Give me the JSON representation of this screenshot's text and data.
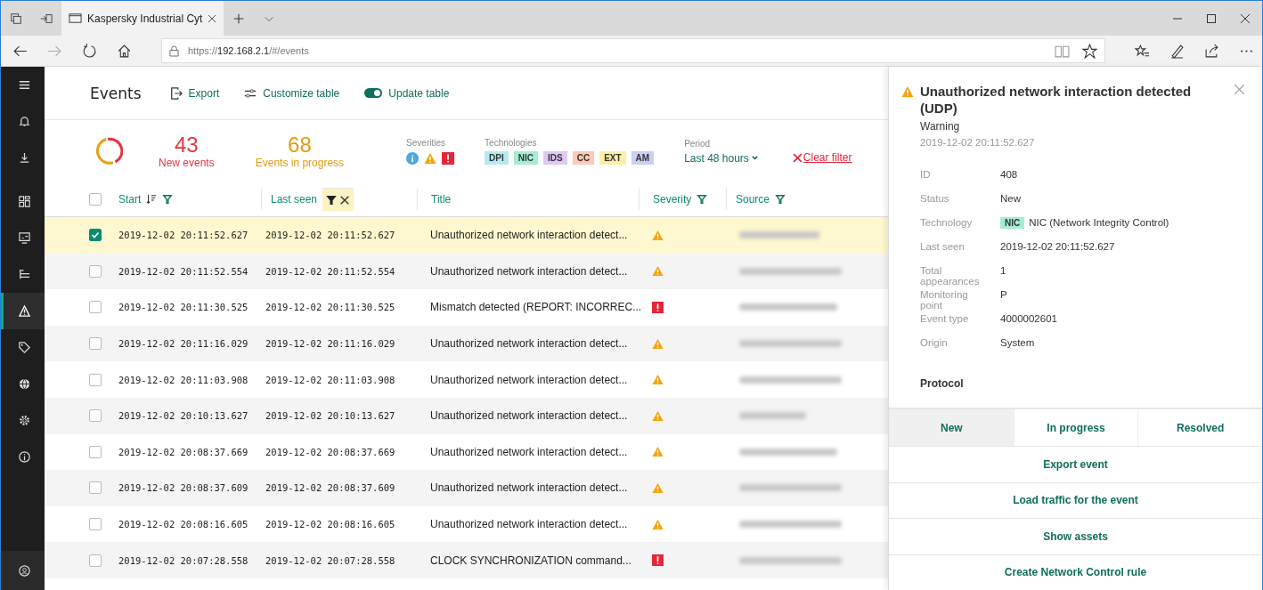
{
  "browser": {
    "tab_title": "Kaspersky Industrial Cyt",
    "url": {
      "scheme": "https://",
      "host": "192.168.2.1",
      "path": "/#/events"
    }
  },
  "sidebar": {
    "items": [
      {
        "selected": false
      },
      {
        "selected": false
      },
      {
        "selected": false
      },
      {
        "selected": false
      },
      {
        "selected": false
      },
      {
        "selected": false
      },
      {
        "selected": true
      },
      {
        "selected": false
      },
      {
        "selected": false
      },
      {
        "selected": false
      },
      {
        "selected": false
      }
    ]
  },
  "toolbar": {
    "title": "Events",
    "export": "Export",
    "customize": "Customize table",
    "update": {
      "label": "Update table",
      "on": true
    }
  },
  "stats": {
    "new_count": "43",
    "new_label": "New events",
    "progress_count": "68",
    "progress_label": "Events in progress"
  },
  "filters": {
    "severities_label": "Severities",
    "severities": [
      {
        "kind": "info"
      },
      {
        "kind": "warning"
      },
      {
        "kind": "error"
      }
    ],
    "technologies_label": "Technologies",
    "technologies": [
      {
        "label": "DPI",
        "color": "#b3ecf0"
      },
      {
        "label": "NIC",
        "color": "#a6ecd0"
      },
      {
        "label": "IDS",
        "color": "#dfc9f5"
      },
      {
        "label": "CC",
        "color": "#fcc9b8"
      },
      {
        "label": "EXT",
        "color": "#fcefa6"
      },
      {
        "label": "AM",
        "color": "#c9cff5"
      }
    ],
    "period_label": "Period",
    "period": "Last 48 hours",
    "clear": "Clear filter"
  },
  "table": {
    "select_all_checked": false,
    "columns": [
      {
        "label": "Start",
        "sorted": true,
        "filter": true,
        "filter_active": false
      },
      {
        "label": "Last seen",
        "sorted": false,
        "filter": true,
        "filter_active": true
      },
      {
        "label": "Title",
        "sorted": false,
        "filter": false,
        "filter_active": false
      },
      {
        "label": "Severity",
        "sorted": false,
        "filter": true,
        "filter_active": false
      },
      {
        "label": "Source",
        "sorted": false,
        "filter": true,
        "filter_active": false
      }
    ],
    "rows": [
      {
        "checked": true,
        "selected": true,
        "start": "2019-12-02 20:11:52.627",
        "last_seen": "2019-12-02 20:11:52.627",
        "title": "Unauthorized network interaction detect...",
        "kind": "warning"
      },
      {
        "checked": false,
        "selected": false,
        "start": "2019-12-02 20:11:52.554",
        "last_seen": "2019-12-02 20:11:52.554",
        "title": "Unauthorized network interaction detect...",
        "kind": "warning"
      },
      {
        "checked": false,
        "selected": false,
        "start": "2019-12-02 20:11:30.525",
        "last_seen": "2019-12-02 20:11:30.525",
        "title": "Mismatch detected (REPORT: INCORREC...",
        "kind": "error"
      },
      {
        "checked": false,
        "selected": false,
        "start": "2019-12-02 20:11:16.029",
        "last_seen": "2019-12-02 20:11:16.029",
        "title": "Unauthorized network interaction detect...",
        "kind": "warning"
      },
      {
        "checked": false,
        "selected": false,
        "start": "2019-12-02 20:11:03.908",
        "last_seen": "2019-12-02 20:11:03.908",
        "title": "Unauthorized network interaction detect...",
        "kind": "warning"
      },
      {
        "checked": false,
        "selected": false,
        "start": "2019-12-02 20:10:13.627",
        "last_seen": "2019-12-02 20:10:13.627",
        "title": "Unauthorized network interaction detect...",
        "kind": "warning"
      },
      {
        "checked": false,
        "selected": false,
        "start": "2019-12-02 20:08:37.669",
        "last_seen": "2019-12-02 20:08:37.669",
        "title": "Unauthorized network interaction detect...",
        "kind": "warning"
      },
      {
        "checked": false,
        "selected": false,
        "start": "2019-12-02 20:08:37.609",
        "last_seen": "2019-12-02 20:08:37.609",
        "title": "Unauthorized network interaction detect...",
        "kind": "warning"
      },
      {
        "checked": false,
        "selected": false,
        "start": "2019-12-02 20:08:16.605",
        "last_seen": "2019-12-02 20:08:16.605",
        "title": "Unauthorized network interaction detect...",
        "kind": "warning"
      },
      {
        "checked": false,
        "selected": false,
        "start": "2019-12-02 20:07:28.558",
        "last_seen": "2019-12-02 20:07:28.558",
        "title": "CLOCK SYNCHRONIZATION command...",
        "kind": "error"
      }
    ]
  },
  "details": {
    "kind": "warning",
    "title": "Unauthorized network interaction detected (UDP)",
    "severity_label": "Warning",
    "time": "2019-12-02 20:11:52.627",
    "fields": [
      {
        "label": "ID",
        "value": "408"
      },
      {
        "label": "Status",
        "value": "New"
      },
      {
        "label": "Technology",
        "tag": "NIC",
        "color": "#a6ecd0",
        "value": "NIC (Network Integrity Control)"
      },
      {
        "label": "Last seen",
        "value": "2019-12-02 20:11:52.627"
      },
      {
        "label": "Total appearances",
        "value": "1"
      },
      {
        "label": "Monitoring point",
        "value": "P"
      },
      {
        "label": "Event type",
        "value": "4000002601"
      },
      {
        "label": "Origin",
        "value": "System"
      }
    ],
    "section": "Protocol",
    "statuses": [
      {
        "label": "New",
        "selected": true
      },
      {
        "label": "In progress",
        "selected": false
      },
      {
        "label": "Resolved",
        "selected": false
      }
    ],
    "actions": [
      "Export event",
      "Load traffic for the event",
      "Show assets",
      "Create Network Control rule"
    ]
  }
}
